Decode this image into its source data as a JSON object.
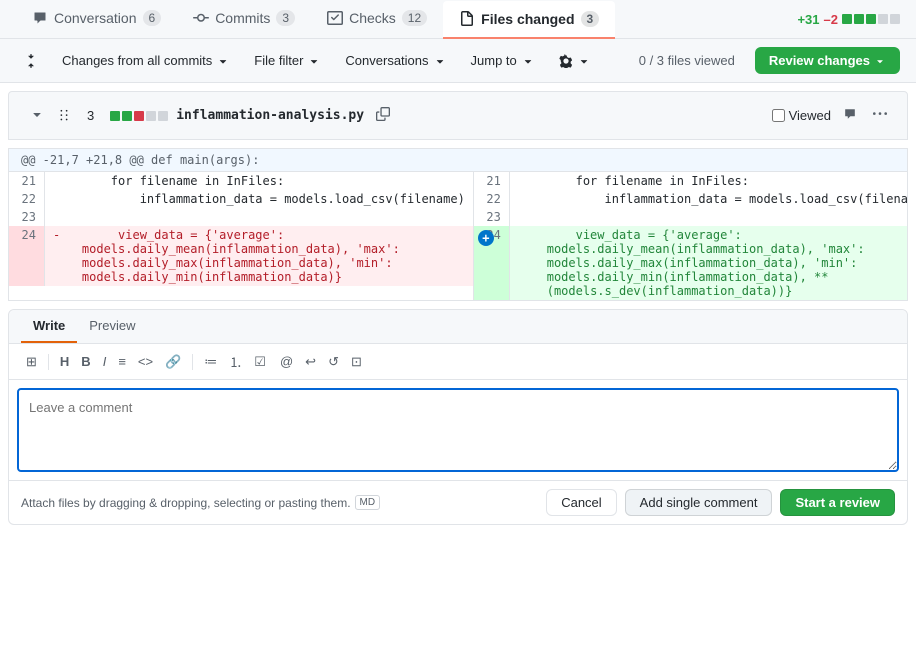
{
  "tabs": [
    {
      "id": "conversation",
      "label": "Conversation",
      "badge": "6",
      "icon": "conversation"
    },
    {
      "id": "commits",
      "label": "Commits",
      "badge": "3",
      "icon": "commits"
    },
    {
      "id": "checks",
      "label": "Checks",
      "badge": "12",
      "icon": "checks"
    },
    {
      "id": "files_changed",
      "label": "Files changed",
      "badge": "3",
      "icon": "files",
      "active": true
    }
  ],
  "stats": {
    "additions": "+31",
    "deletions": "–2",
    "blocks": [
      "green",
      "green",
      "green",
      "gray",
      "gray"
    ]
  },
  "toolbar": {
    "commits_filter": "Changes from all commits",
    "file_filter": "File filter",
    "conversations": "Conversations",
    "jump_to": "Jump to",
    "settings": "",
    "files_viewed": "0 / 3 files viewed",
    "review_btn": "Review changes"
  },
  "file": {
    "count": "3",
    "diff_stats": [
      "+",
      "+",
      "-",
      "-",
      "neutral"
    ],
    "name": "inflammation-analysis.py",
    "viewed_label": "Viewed"
  },
  "hunk_header": "@@ -21,7 +21,8 @@ def main(args):",
  "diff_rows": [
    {
      "left_num": "21",
      "right_num": "21",
      "type": "normal",
      "content": "        for filename in InFiles:"
    },
    {
      "left_num": "22",
      "right_num": "22",
      "type": "normal",
      "content": "            inflammation_data = models.load_csv(filename)"
    },
    {
      "left_num": "23",
      "right_num": "23",
      "type": "normal",
      "content": ""
    },
    {
      "left_num": "24",
      "right_num": "24",
      "type": "changed",
      "left_content": "-        view_data = {'average':\n    models.daily_mean(inflammation_data), 'max':\n    models.daily_max(inflammation_data), 'min':\n    models.daily_min(inflammation_data)}",
      "right_content": "        view_data = {'average':\n    models.daily_mean(inflammation_data), 'max':\n    models.daily_max(inflammation_data), 'min':\n    models.daily_min(inflammation_data), **\n    (models.s_dev(inflammation_data))}"
    }
  ],
  "comment": {
    "write_tab": "Write",
    "preview_tab": "Preview",
    "placeholder": "Leave a comment",
    "footer_info": "Attach files by dragging & dropping, selecting or pasting them.",
    "cancel_label": "Cancel",
    "add_comment_label": "Add single comment",
    "start_review_label": "Start a review"
  }
}
